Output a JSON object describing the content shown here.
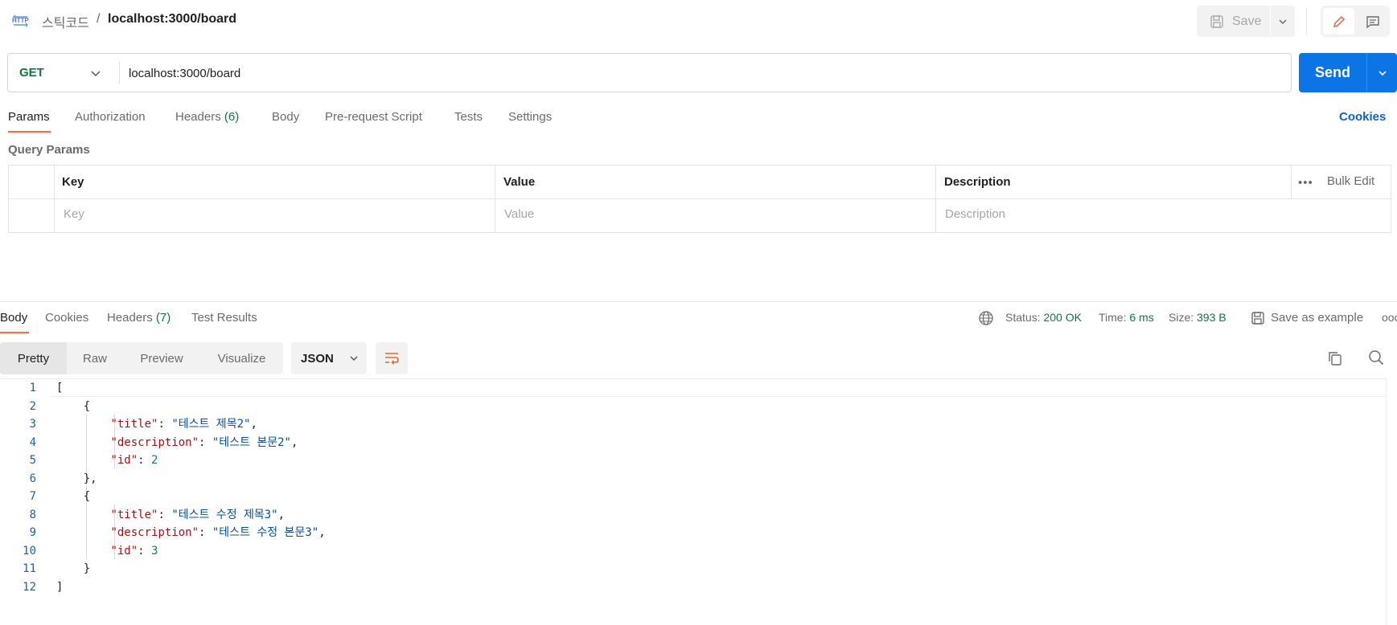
{
  "header": {
    "protocol_icon_label": "HTTP",
    "workspace": "스틱코드",
    "separator": "/",
    "request_name": "localhost:3000/board",
    "save_label": "Save"
  },
  "request": {
    "method": "GET",
    "url": "localhost:3000/board",
    "send_label": "Send"
  },
  "request_tabs": {
    "params": "Params",
    "authorization": "Authorization",
    "headers": "Headers",
    "headers_count": "(6)",
    "body": "Body",
    "pre_request": "Pre-request Script",
    "tests": "Tests",
    "settings": "Settings",
    "cookies": "Cookies"
  },
  "query_params": {
    "title": "Query Params",
    "columns": [
      "Key",
      "Value",
      "Description"
    ],
    "placeholders": [
      "Key",
      "Value",
      "Description"
    ],
    "more": "•••",
    "bulk_edit": "Bulk Edit"
  },
  "response_tabs": {
    "body": "Body",
    "cookies": "Cookies",
    "headers": "Headers",
    "headers_count": "(7)",
    "test_results": "Test Results"
  },
  "response_meta": {
    "status_label": "Status:",
    "status_value": "200 OK",
    "time_label": "Time:",
    "time_value": "6 ms",
    "size_label": "Size:",
    "size_value": "393 B",
    "save_example": "Save as example",
    "more": "ooo"
  },
  "view_tabs": [
    "Pretty",
    "Raw",
    "Preview",
    "Visualize"
  ],
  "format": "JSON",
  "code_lines": [
    {
      "n": "1",
      "indent": "",
      "parts": [
        [
          "p",
          "["
        ]
      ]
    },
    {
      "n": "2",
      "indent": "    ",
      "parts": [
        [
          "p",
          "{"
        ]
      ]
    },
    {
      "n": "3",
      "indent": "        ",
      "parts": [
        [
          "k",
          "\"title\""
        ],
        [
          "p",
          ": "
        ],
        [
          "s",
          "\"테스트 제목2\""
        ],
        [
          "p",
          ","
        ]
      ]
    },
    {
      "n": "4",
      "indent": "        ",
      "parts": [
        [
          "k",
          "\"description\""
        ],
        [
          "p",
          ": "
        ],
        [
          "s",
          "\"테스트 본문2\""
        ],
        [
          "p",
          ","
        ]
      ]
    },
    {
      "n": "5",
      "indent": "        ",
      "parts": [
        [
          "k",
          "\"id\""
        ],
        [
          "p",
          ": "
        ],
        [
          "n",
          "2"
        ]
      ]
    },
    {
      "n": "6",
      "indent": "    ",
      "parts": [
        [
          "p",
          "},"
        ]
      ]
    },
    {
      "n": "7",
      "indent": "    ",
      "parts": [
        [
          "p",
          "{"
        ]
      ]
    },
    {
      "n": "8",
      "indent": "        ",
      "parts": [
        [
          "k",
          "\"title\""
        ],
        [
          "p",
          ": "
        ],
        [
          "s",
          "\"테스트 수정 제목3\""
        ],
        [
          "p",
          ","
        ]
      ]
    },
    {
      "n": "9",
      "indent": "        ",
      "parts": [
        [
          "k",
          "\"description\""
        ],
        [
          "p",
          ": "
        ],
        [
          "s",
          "\"테스트 수정 본문3\""
        ],
        [
          "p",
          ","
        ]
      ]
    },
    {
      "n": "10",
      "indent": "        ",
      "parts": [
        [
          "k",
          "\"id\""
        ],
        [
          "p",
          ": "
        ],
        [
          "n",
          "3"
        ]
      ]
    },
    {
      "n": "11",
      "indent": "    ",
      "parts": [
        [
          "p",
          "}"
        ]
      ]
    },
    {
      "n": "12",
      "indent": "",
      "parts": [
        [
          "p",
          "]"
        ]
      ]
    }
  ],
  "colors": {
    "accent_orange": "#ff6c37",
    "send_blue": "#0c74e4",
    "method_green": "#0b7a3e",
    "link_blue": "#0c62cf"
  },
  "icons": [
    "http-icon",
    "save-icon",
    "chevron-down-icon",
    "pencil-icon",
    "comment-icon",
    "globe-icon",
    "copy-icon",
    "search-icon",
    "wrap-lines-icon"
  ]
}
